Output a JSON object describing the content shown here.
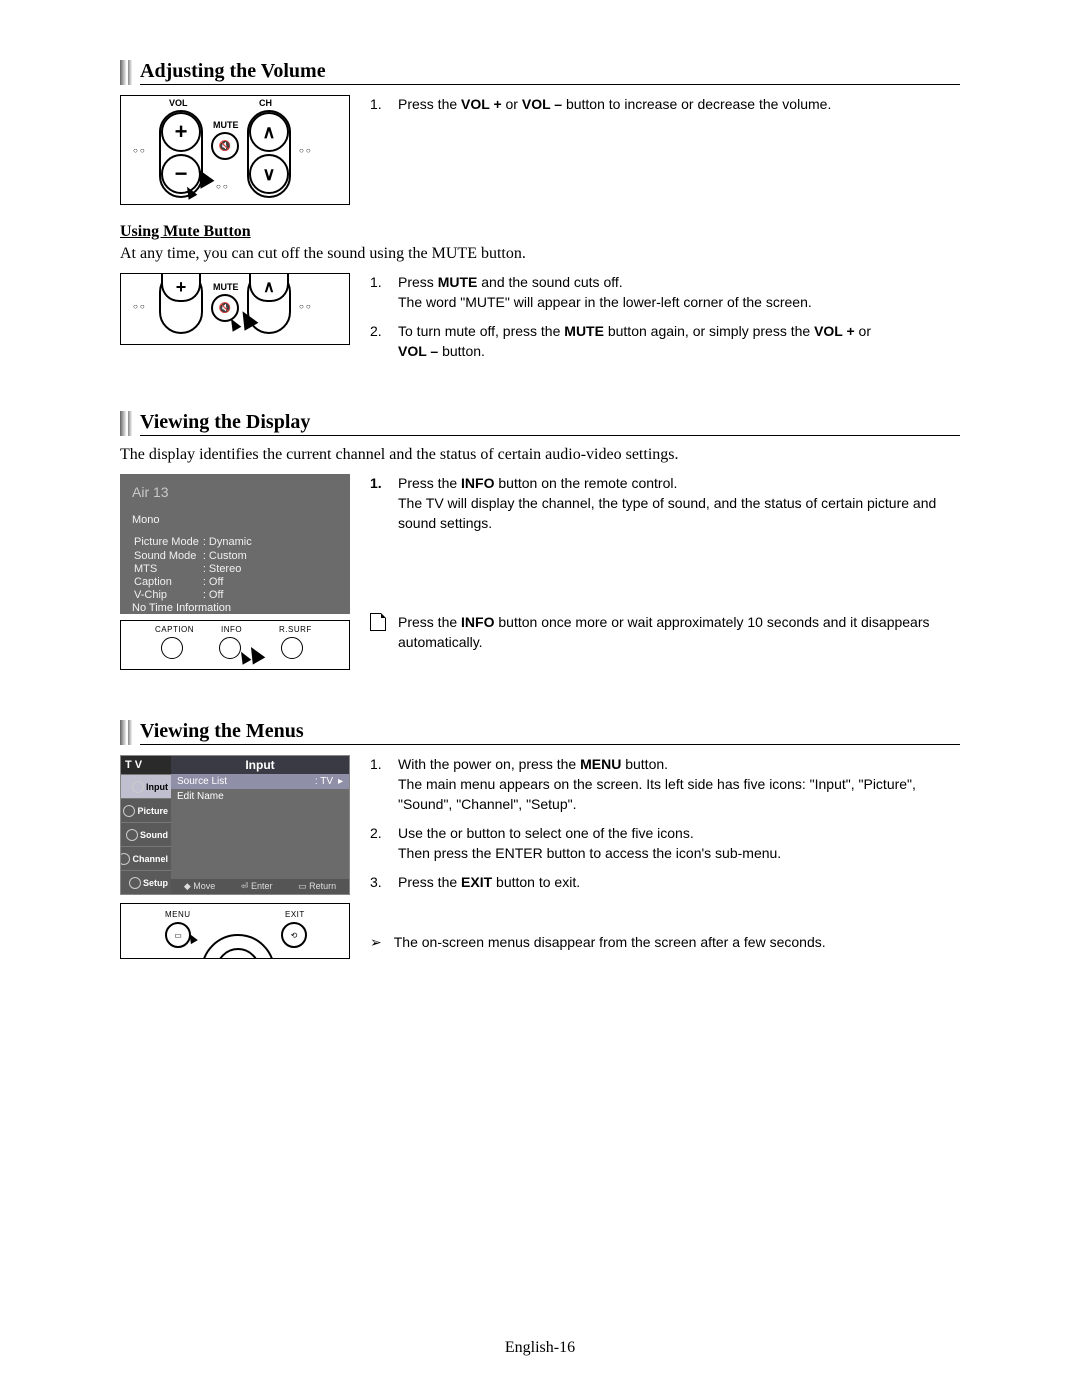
{
  "page_number": "English-16",
  "sections": {
    "volume": {
      "title": "Adjusting the Volume",
      "step1_num": "1.",
      "step1_text_pre": "Press the ",
      "step1_b1": "VOL +",
      "step1_mid": " or ",
      "step1_b2": "VOL –",
      "step1_text_post": " button to increase or decrease the volume.",
      "mute_subhead": "Using Mute Button",
      "mute_intro": "At any time, you can cut off the sound using the MUTE button.",
      "mute_s1_num": "1.",
      "mute_s1_pre": "Press ",
      "mute_s1_b": "MUTE",
      "mute_s1_post": " and the sound cuts off.",
      "mute_s1_line2": "The word \"MUTE\" will appear in the lower-left corner of the screen.",
      "mute_s2_num": "2.",
      "mute_s2_pre": "To turn mute off, press the ",
      "mute_s2_b1": "MUTE",
      "mute_s2_mid": " button again, or simply press the ",
      "mute_s2_b2": "VOL +",
      "mute_s2_or": " or ",
      "mute_s2_b3": "VOL –",
      "mute_s2_post": " button."
    },
    "display": {
      "title": "Viewing the Display",
      "intro": "The display identifies the current channel and the status of certain audio-video settings.",
      "osd": {
        "channel": "Air  13",
        "mono": "Mono",
        "rows": [
          [
            "Picture Mode",
            ": Dynamic"
          ],
          [
            "Sound Mode",
            ": Custom"
          ],
          [
            "MTS",
            ": Stereo"
          ],
          [
            "Caption",
            ": Off"
          ],
          [
            "V-Chip",
            ": Off"
          ]
        ],
        "notime": "No Time Information"
      },
      "s1_num": "1.",
      "s1_pre": "Press the ",
      "s1_b": "INFO",
      "s1_post": " button on the remote control.",
      "s1_line2": "The TV will display the channel, the type of sound, and the status of certain picture and sound settings.",
      "note_pre": "Press the ",
      "note_b": "INFO",
      "note_post": " button once more or wait approximately 10 seconds and it disappears automatically.",
      "remote_labels": {
        "caption": "CAPTION",
        "info": "INFO",
        "rsurf": "R.SURF"
      }
    },
    "menus": {
      "title": "Viewing the Menus",
      "osd": {
        "tv": "T V",
        "title": "Input",
        "side_items": [
          "Input",
          "Picture",
          "Sound",
          "Channel",
          "Setup"
        ],
        "rows": [
          [
            "Source List",
            ": TV"
          ],
          [
            "Edit Name",
            ""
          ]
        ],
        "footer": {
          "move": "Move",
          "enter": "Enter",
          "return": "Return"
        }
      },
      "s1_num": "1.",
      "s1_pre": "With the power on, press the ",
      "s1_b": "MENU",
      "s1_post": " button.",
      "s1_line2": "The main menu appears on the screen. Its left side has five icons: \"Input\", \"Picture\", \"Sound\", \"Channel\", \"Setup\".",
      "s2_num": "2.",
      "s2_pre": "Use the      or      button to select one of the five icons.",
      "s2_line2": "Then press the ENTER button to access the icon's sub-menu.",
      "s3_num": "3.",
      "s3_pre": "Press the ",
      "s3_b": "EXIT",
      "s3_post": " button to exit.",
      "note": "The on-screen menus disappear from the screen after a few seconds.",
      "remote_labels": {
        "menu": "MENU",
        "exit": "EXIT"
      }
    },
    "remote_generic": {
      "vol": "VOL",
      "ch": "CH",
      "mute": "MUTE"
    }
  }
}
